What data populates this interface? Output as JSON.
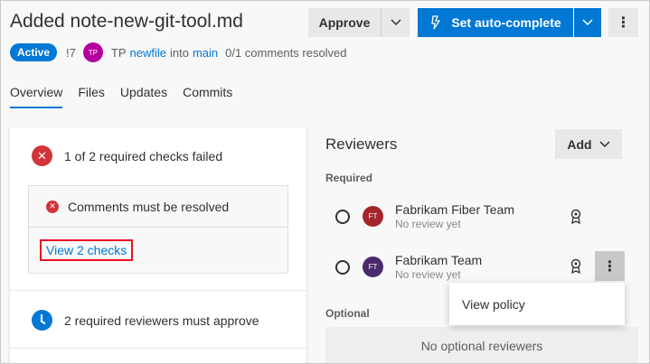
{
  "header": {
    "title": "Added note-new-git-tool.md",
    "approve_label": "Approve",
    "auto_complete_label": "Set auto-complete"
  },
  "meta": {
    "status_badge": "Active",
    "pr_id": "!7",
    "avatar_initials": "TP",
    "author": "TP",
    "source_branch": "newfile",
    "into_text": "into",
    "target_branch": "main",
    "comments_status": "0/1 comments resolved"
  },
  "tabs": [
    "Overview",
    "Files",
    "Updates",
    "Commits"
  ],
  "checks": {
    "summary": "1 of 2 required checks failed",
    "comments_item": "Comments must be resolved",
    "view_checks_link": "View 2 checks",
    "reviewers_required": "2 required reviewers must approve"
  },
  "reviewers": {
    "title": "Reviewers",
    "add_label": "Add",
    "required_label": "Required",
    "required": [
      {
        "initials": "FT",
        "name": "Fabrikam Fiber Team",
        "status": "No review yet",
        "avatar_color": "#a4262c"
      },
      {
        "initials": "FT",
        "name": "Fabrikam Team",
        "status": "No review yet",
        "avatar_color": "#4b2a6b"
      }
    ],
    "optional_label": "Optional",
    "no_optional_text": "No optional reviewers"
  },
  "context_menu": {
    "view_policy_label": "View policy"
  },
  "colors": {
    "accent": "#0078d4",
    "error": "#d13438",
    "author_avatar": "#b4009e"
  }
}
